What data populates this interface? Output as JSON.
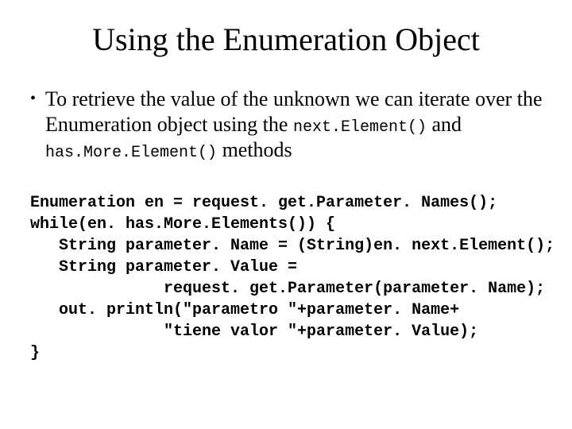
{
  "title": "Using the Enumeration Object",
  "bullet": {
    "part1": "To retrieve the value of the unknown we can iterate over the Enumeration object using the ",
    "code1": "next.Element()",
    "part2": " and ",
    "code2": "has.More.Element()",
    "part3": " methods"
  },
  "code": {
    "l1": "Enumeration en = request. get.Parameter. Names();",
    "l2": "while(en. has.More.Elements()) {",
    "l3": "   String parameter. Name = (String)en. next.Element();",
    "l4": "   String parameter. Value =",
    "l5": "              request. get.Parameter(parameter. Name);",
    "l6": "   out. println(\"parametro \"+parameter. Name+",
    "l7": "              \"tiene valor \"+parameter. Value);",
    "l8": "}"
  }
}
